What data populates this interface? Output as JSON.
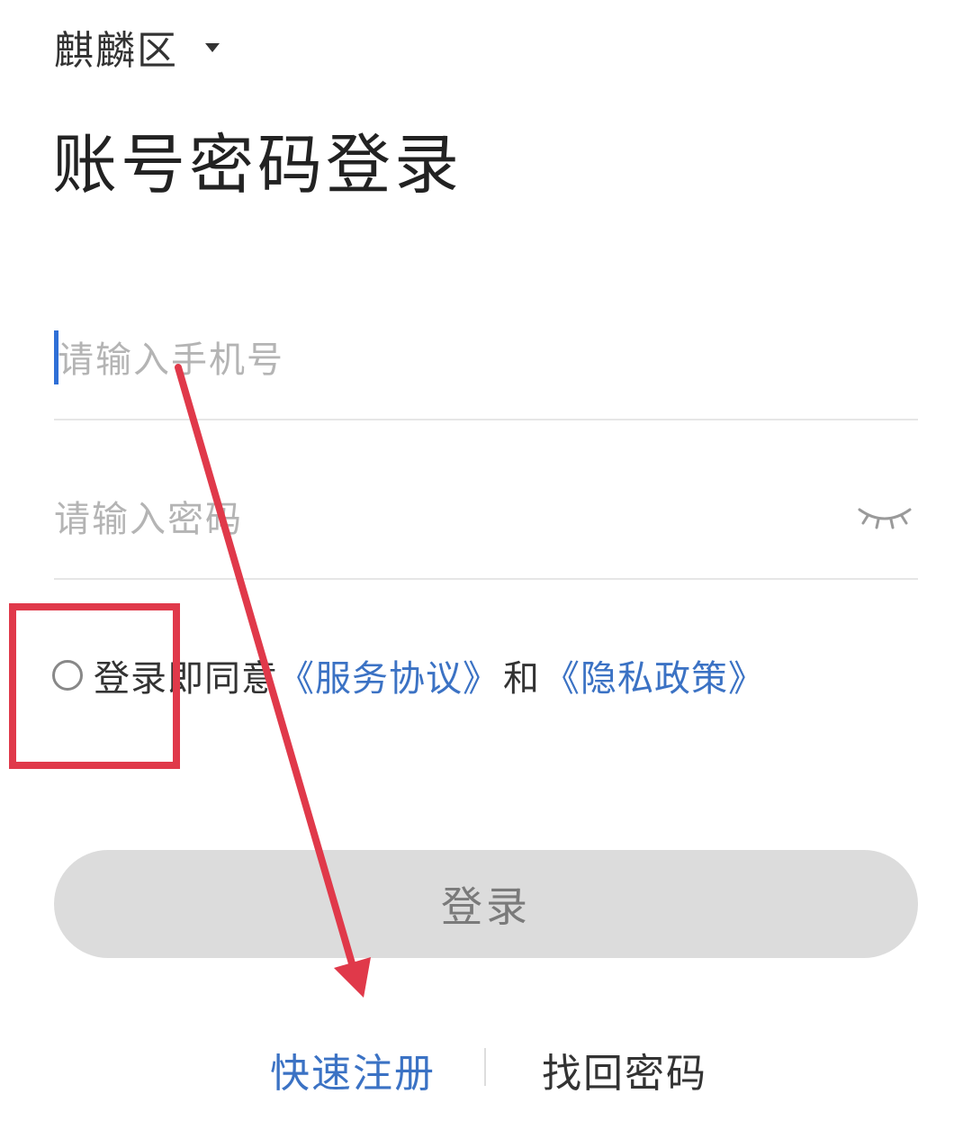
{
  "region": {
    "label": "麒麟区",
    "caret_icon": "caret-down-icon"
  },
  "page_title": "账号密码登录",
  "phone_field": {
    "placeholder": "请输入手机号",
    "value": ""
  },
  "password_field": {
    "placeholder": "请输入密码",
    "value": "",
    "visibility_icon": "eye-closed-icon"
  },
  "agreement": {
    "checked": false,
    "prefix": "登录即同意",
    "service_link": "《服务协议》",
    "conjunction": "和",
    "privacy_link": "《隐私政策》"
  },
  "login_button": {
    "label": "登录"
  },
  "footer": {
    "register_label": "快速注册",
    "find_password_label": "找回密码"
  },
  "colors": {
    "link": "#3b72c4",
    "button_bg": "#dcdcdc",
    "annotation": "#e0394a",
    "cursor": "#2f6fd6"
  }
}
